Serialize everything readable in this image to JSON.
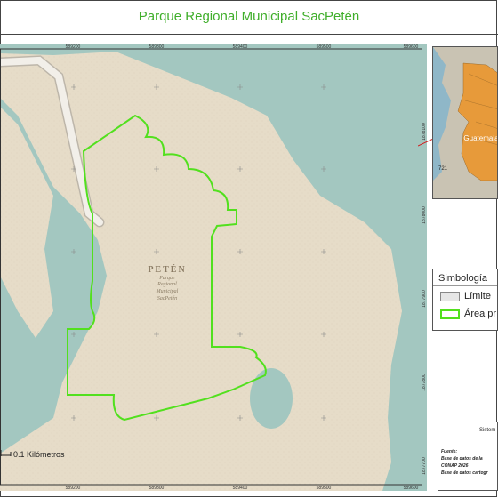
{
  "title": "Parque Regional Municipal SacPetén",
  "map": {
    "place_label": "PETÉN",
    "park_label_lines": [
      "Parque",
      "Regional",
      "Municipal",
      "SacPetén"
    ],
    "x_ticks": [
      "589200",
      "589300",
      "589400",
      "589500",
      "589600"
    ],
    "y_ticks": [
      "1878100",
      "1878000",
      "1877900",
      "1877800",
      "1877700"
    ],
    "colors": {
      "land": "#e6dcc8",
      "water": "#a3c7c0",
      "park_outline": "#52e01e"
    }
  },
  "inset": {
    "label_country": "Guatemala",
    "label_route": "721",
    "colors": {
      "country_fill": "#e79a3a",
      "extent_line": "#d02020"
    }
  },
  "legend": {
    "title": "Simbología",
    "items": [
      {
        "label": "Límite",
        "fill": "#e6e6e6",
        "stroke": "#888888"
      },
      {
        "label": "Área pr",
        "fill": "#ffffff",
        "stroke": "#52e01e"
      }
    ]
  },
  "scale_bar": {
    "label": "0.1 Kilómetros"
  },
  "info": {
    "title": "Sistem",
    "lines": [
      "Fuente:",
      "Base de datos de la",
      "CONAP 2026",
      "Base de datos cartogr"
    ]
  }
}
